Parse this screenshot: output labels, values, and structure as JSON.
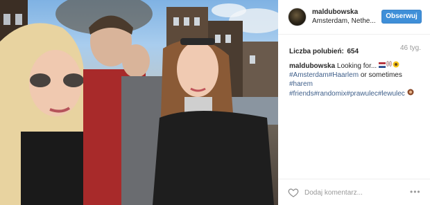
{
  "header": {
    "username": "maldubowska",
    "location": "Amsterdam, Nethe...",
    "follow_label": "Obserwuj"
  },
  "stats": {
    "likes_label": "Liczba polubień:",
    "likes_count": "654",
    "age": "46 tyg."
  },
  "caption": {
    "username": "maldubowska",
    "text_start": "Looking for...",
    "tag_amsterdam": "#Amsterdam",
    "tag_haarlem": "#Haarlem",
    "text_mid": "or sometimes",
    "tag_harem": "#harem",
    "tag_friends": "#friends",
    "tag_randomix": "#randomix",
    "tag_prawulec": "#prawulec",
    "tag_lewulec": "#lewulec",
    "emojis": [
      "flag-netherlands",
      "rabbit-ears",
      "sunflower",
      "circle-face"
    ]
  },
  "footer": {
    "comment_placeholder": "Dodaj komentarz...",
    "more_label": "•••"
  },
  "colors": {
    "follow_button": "#3f8fd8",
    "hashtag": "#3f5f8a",
    "muted_text": "#999999"
  },
  "icons": {
    "like": "heart-icon",
    "more": "more-options-icon"
  }
}
